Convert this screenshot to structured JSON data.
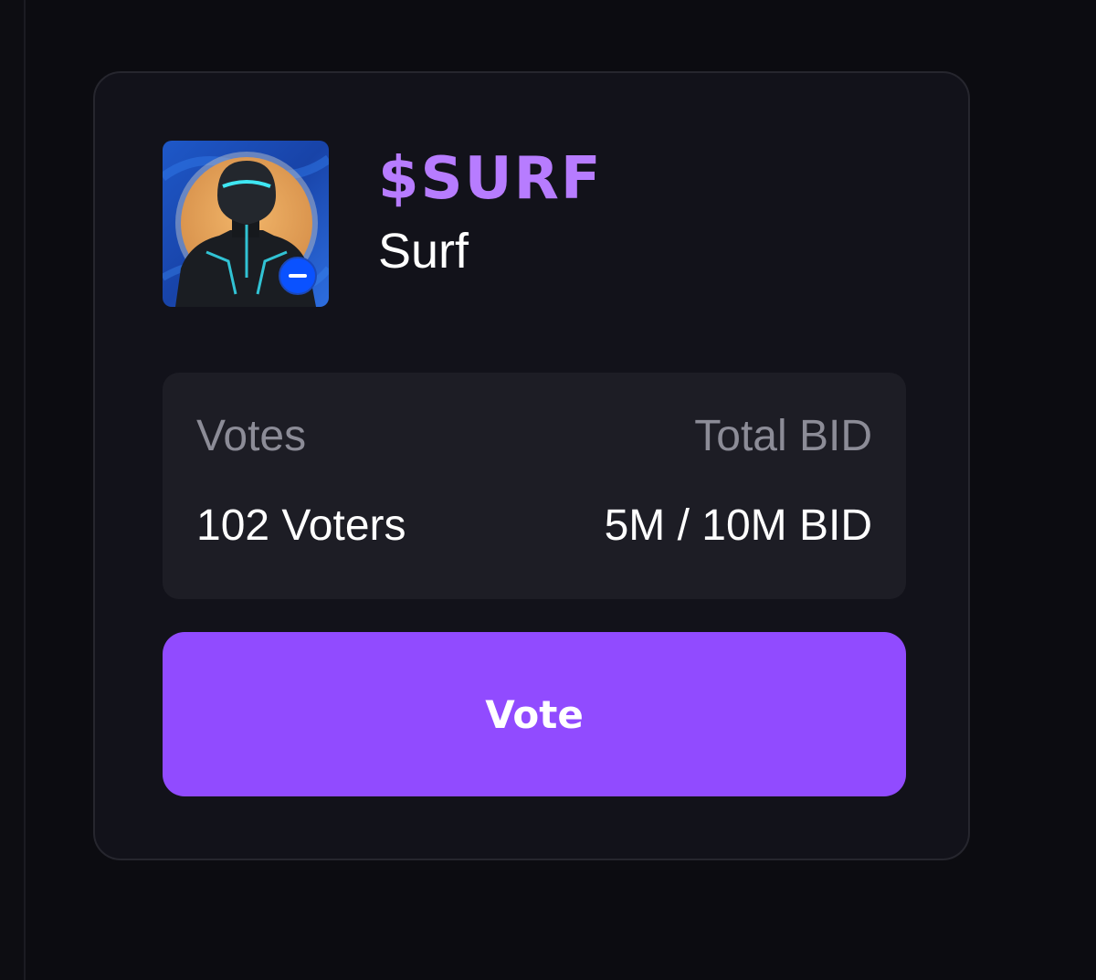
{
  "token": {
    "ticker": "$SURF",
    "name": "Surf",
    "avatar_icon": "surfer-avatar-icon",
    "chain_badge_icon": "base-chain-icon"
  },
  "stats": {
    "votes_label": "Votes",
    "votes_value": "102 Voters",
    "total_bid_label": "Total BID",
    "total_bid_value": "5M / 10M BID"
  },
  "actions": {
    "vote_label": "Vote"
  },
  "colors": {
    "page_background": "#0c0c11",
    "card_background": "#12121a",
    "panel_background": "#1d1d25",
    "ticker": "#b77cff",
    "accent": "#914bff",
    "muted_text": "#8c8c97",
    "badge": "#0a52ff"
  }
}
